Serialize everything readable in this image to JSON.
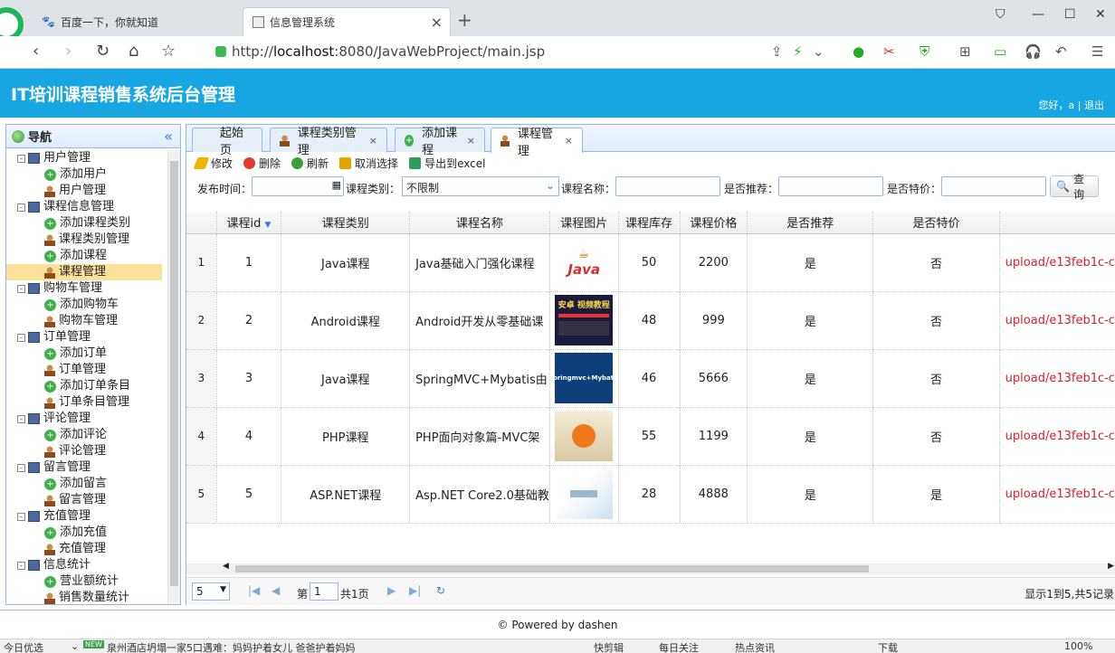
{
  "browser": {
    "tabs": [
      {
        "title": "百度一下，你就知道"
      },
      {
        "title": "信息管理系统"
      }
    ],
    "url_prefix": "http://",
    "url_host": "localhost",
    "url_rest": ":8080/JavaWebProject/main.jsp"
  },
  "app": {
    "title": "IT培训课程销售系统后台管理",
    "user_info": "您好，a | 退出"
  },
  "sidebar": {
    "header": "导航",
    "tree": [
      {
        "label": "用户管理",
        "level": 0,
        "icon": "folder"
      },
      {
        "label": "添加用户",
        "level": 1,
        "icon": "plus"
      },
      {
        "label": "用户管理",
        "level": 1,
        "icon": "user"
      },
      {
        "label": "课程信息管理",
        "level": 0,
        "icon": "folder"
      },
      {
        "label": "添加课程类别",
        "level": 1,
        "icon": "plus"
      },
      {
        "label": "课程类别管理",
        "level": 1,
        "icon": "user"
      },
      {
        "label": "添加课程",
        "level": 1,
        "icon": "plus"
      },
      {
        "label": "课程管理",
        "level": 1,
        "icon": "user",
        "selected": true
      },
      {
        "label": "购物车管理",
        "level": 0,
        "icon": "folder"
      },
      {
        "label": "添加购物车",
        "level": 1,
        "icon": "plus"
      },
      {
        "label": "购物车管理",
        "level": 1,
        "icon": "user"
      },
      {
        "label": "订单管理",
        "level": 0,
        "icon": "folder"
      },
      {
        "label": "添加订单",
        "level": 1,
        "icon": "plus"
      },
      {
        "label": "订单管理",
        "level": 1,
        "icon": "user"
      },
      {
        "label": "添加订单条目",
        "level": 1,
        "icon": "plus"
      },
      {
        "label": "订单条目管理",
        "level": 1,
        "icon": "user"
      },
      {
        "label": "评论管理",
        "level": 0,
        "icon": "folder"
      },
      {
        "label": "添加评论",
        "level": 1,
        "icon": "plus"
      },
      {
        "label": "评论管理",
        "level": 1,
        "icon": "user"
      },
      {
        "label": "留言管理",
        "level": 0,
        "icon": "folder"
      },
      {
        "label": "添加留言",
        "level": 1,
        "icon": "plus"
      },
      {
        "label": "留言管理",
        "level": 1,
        "icon": "user"
      },
      {
        "label": "充值管理",
        "level": 0,
        "icon": "folder"
      },
      {
        "label": "添加充值",
        "level": 1,
        "icon": "plus"
      },
      {
        "label": "充值管理",
        "level": 1,
        "icon": "user"
      },
      {
        "label": "信息统计",
        "level": 0,
        "icon": "folder"
      },
      {
        "label": "营业额统计",
        "level": 1,
        "icon": "plus"
      },
      {
        "label": "销售数量统计",
        "level": 1,
        "icon": "user"
      }
    ]
  },
  "tabs": [
    {
      "label": "起始页",
      "closable": false
    },
    {
      "label": "课程类别管理",
      "closable": true
    },
    {
      "label": "添加课程",
      "closable": true
    },
    {
      "label": "课程管理",
      "closable": true,
      "active": true
    }
  ],
  "toolbar": {
    "edit": "修改",
    "delete": "删除",
    "refresh": "刷新",
    "cancel_select": "取消选择",
    "export": "导出到excel"
  },
  "search": {
    "publish_time_label": "发布时间：",
    "category_label": "课程类别：",
    "category_value": "不限制",
    "name_label": "课程名称：",
    "recommend_label": "是否推荐：",
    "special_label": "是否特价：",
    "query_button": "查询"
  },
  "table": {
    "columns": [
      "课程id",
      "课程类别",
      "课程名称",
      "课程图片",
      "课程库存",
      "课程价格",
      "是否推荐",
      "是否特价"
    ],
    "rows": [
      {
        "rn": "1",
        "id": "1",
        "category": "Java课程",
        "name": "Java基础入门强化课程",
        "stock": "50",
        "price": "2200",
        "recommend": "是",
        "special": "否",
        "path": "upload/e13feb1c-c",
        "pic": "java"
      },
      {
        "rn": "2",
        "id": "2",
        "category": "Android课程",
        "name": "Android开发从零基础课",
        "stock": "48",
        "price": "999",
        "recommend": "是",
        "special": "否",
        "path": "upload/e13feb1c-c",
        "pic": "android"
      },
      {
        "rn": "3",
        "id": "3",
        "category": "Java课程",
        "name": "SpringMVC+Mybatis由",
        "stock": "46",
        "price": "5666",
        "recommend": "是",
        "special": "否",
        "path": "upload/e13feb1c-c",
        "pic": "spring"
      },
      {
        "rn": "4",
        "id": "4",
        "category": "PHP课程",
        "name": "PHP面向对象篇-MVC架",
        "stock": "55",
        "price": "1199",
        "recommend": "是",
        "special": "否",
        "path": "upload/e13feb1c-c",
        "pic": "php"
      },
      {
        "rn": "5",
        "id": "5",
        "category": "ASP.NET课程",
        "name": "Asp.NET Core2.0基础教",
        "stock": "28",
        "price": "4888",
        "recommend": "是",
        "special": "是",
        "path": "upload/e13feb1c-c",
        "pic": "asp"
      }
    ],
    "pic_texts": {
      "java": "Java",
      "android": "安卓 视频教程",
      "spring": "Springmvc+Mybatis"
    }
  },
  "pager": {
    "page_size": "5",
    "page_prefix": "第",
    "page_value": "1",
    "page_total": "共1页",
    "summary": "显示1到5,共5记录"
  },
  "footer": "© Powered by dashen",
  "statusbar": {
    "left": "今日优选",
    "news_badge": "NEW",
    "news": "泉州酒店坍塌一家5口遇难：妈妈护着女儿 爸爸护着妈妈",
    "items": [
      "快剪辑",
      "每日关注",
      "热点资讯",
      "下载",
      "100%"
    ]
  }
}
